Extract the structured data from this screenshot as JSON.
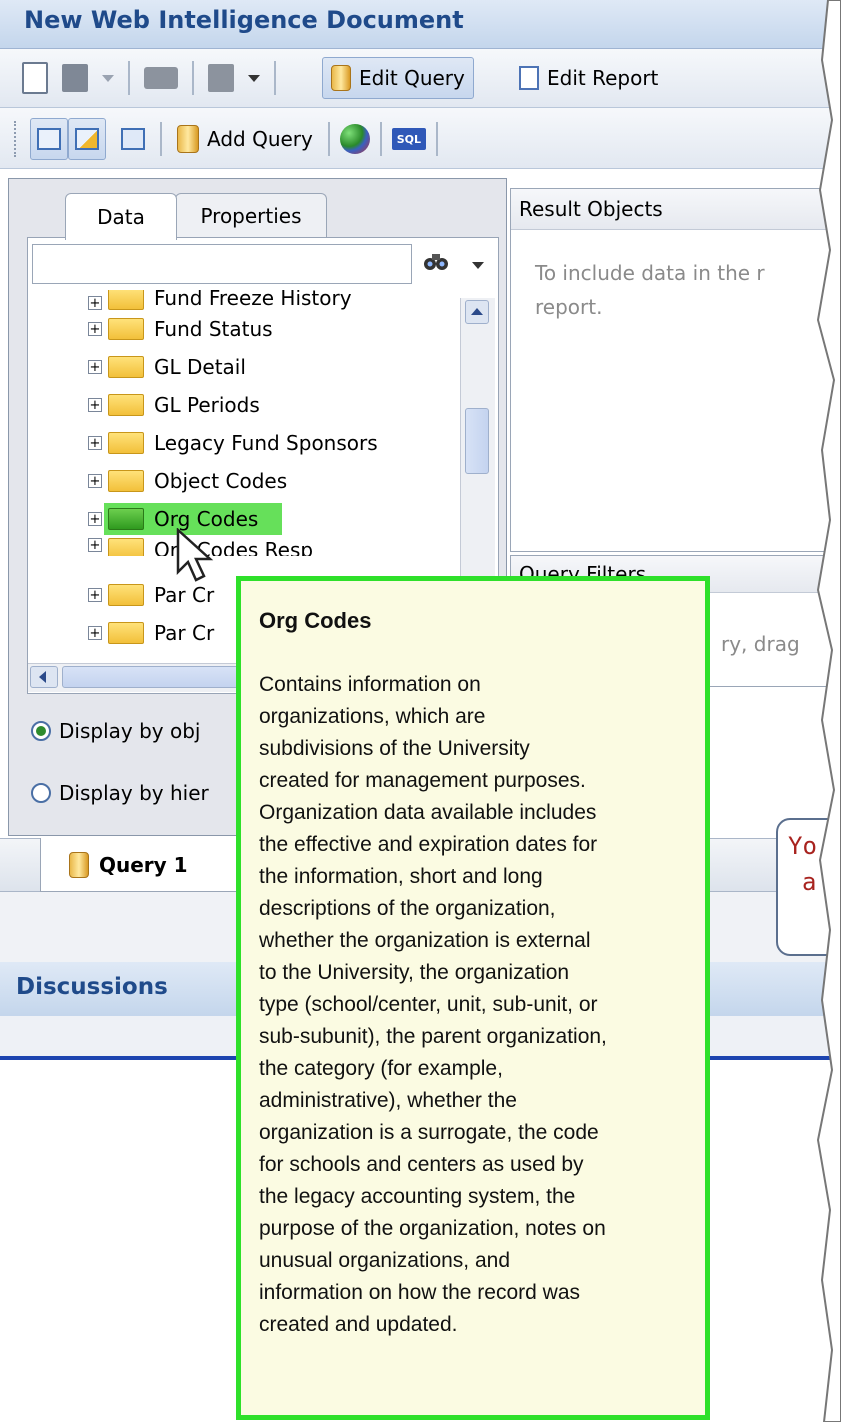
{
  "window": {
    "title": "New Web Intelligence Document"
  },
  "toolbar": {
    "edit_query_label": "Edit Query",
    "edit_report_label": "Edit Report",
    "add_query_label": "Add Query",
    "sql_label": "SQL"
  },
  "left_panel": {
    "tabs": [
      {
        "label": "Data",
        "active": true
      },
      {
        "label": "Properties",
        "active": false
      }
    ],
    "search": {
      "value": "",
      "placeholder": ""
    },
    "tree_items": [
      {
        "label": "Fund Freeze History"
      },
      {
        "label": "Fund Status"
      },
      {
        "label": "GL Detail"
      },
      {
        "label": "GL Periods"
      },
      {
        "label": "Legacy Fund Sponsors"
      },
      {
        "label": "Object Codes"
      },
      {
        "label": "Org Codes",
        "selected": true
      },
      {
        "label": "Org Codes Resp"
      },
      {
        "label": "Par Cr"
      },
      {
        "label": "Par Cr"
      }
    ],
    "display_options": [
      {
        "label": "Display by obj",
        "selected": true
      },
      {
        "label": "Display by hier",
        "selected": false
      }
    ]
  },
  "result_objects": {
    "header": "Result Objects",
    "hint_line1": "To include data in the r",
    "hint_line2": "report."
  },
  "query_filters": {
    "header": "Query Filters",
    "hint": "ry, drag"
  },
  "query_tab": {
    "label": "Query 1"
  },
  "discussions": {
    "header": "Discussions"
  },
  "callout": {
    "line1": "Yo",
    "line2": "a"
  },
  "tooltip": {
    "title": "Org Codes",
    "lines": [
      "Contains information on",
      "organizations, which are",
      "subdivisions of the University",
      "created for management purposes.",
      "Organization data available includes",
      "the effective and expiration dates for",
      "the information, short and long",
      "descriptions of the organization,",
      "whether the organization is external",
      "to the University, the organization",
      "type (school/center, unit, sub-unit, or",
      "sub-subunit), the parent organization,",
      "the category (for example,",
      "administrative), whether the",
      "organization is a surrogate, the code",
      "for schools and centers as used by",
      "the legacy accounting system, the",
      "purpose of the organization, notes on",
      "unusual organizations, and",
      "information on how the record was",
      "created and updated."
    ]
  },
  "colors": {
    "tooltip_border": "#2ee02a",
    "tooltip_bg": "#fbfbe2",
    "selection_highlight": "#66e05a",
    "title_text": "#1f4a8a",
    "discussion_rule": "#1c44b0"
  }
}
